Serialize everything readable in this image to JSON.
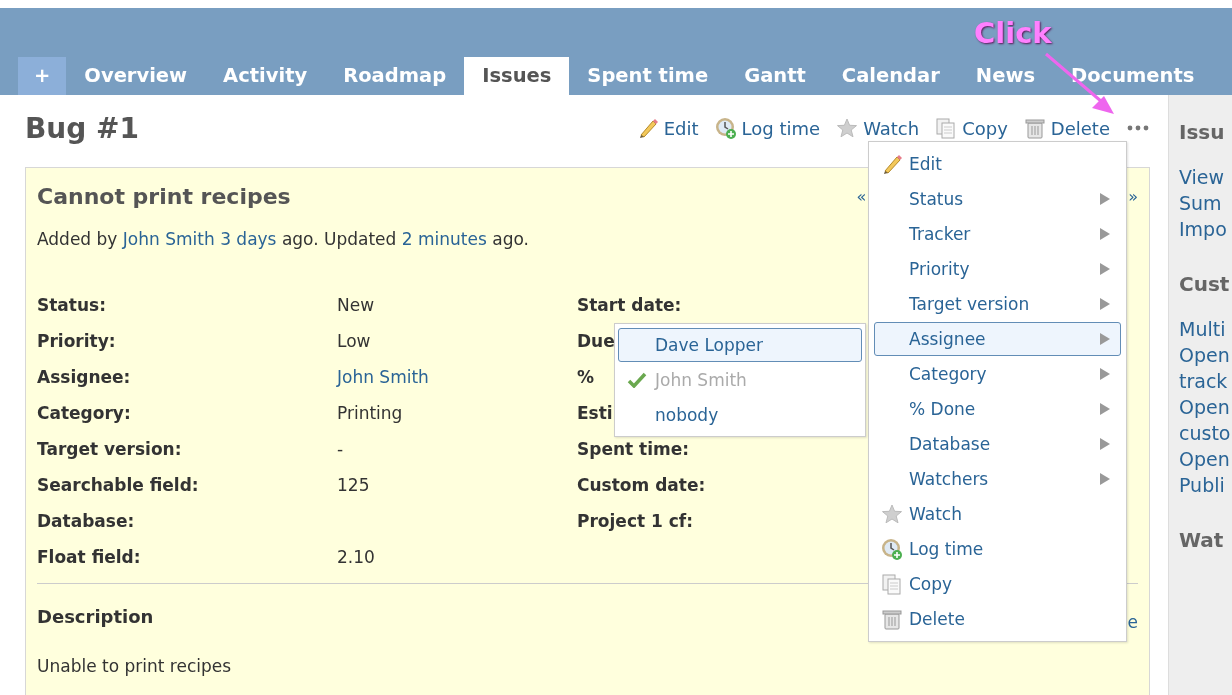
{
  "tabs": [
    {
      "label": "+",
      "kind": "new",
      "selected": false
    },
    {
      "label": "Overview",
      "kind": "tab",
      "selected": false
    },
    {
      "label": "Activity",
      "kind": "tab",
      "selected": false
    },
    {
      "label": "Roadmap",
      "kind": "tab",
      "selected": false
    },
    {
      "label": "Issues",
      "kind": "tab",
      "selected": true
    },
    {
      "label": "Spent time",
      "kind": "tab",
      "selected": false
    },
    {
      "label": "Gantt",
      "kind": "tab",
      "selected": false
    },
    {
      "label": "Calendar",
      "kind": "tab",
      "selected": false
    },
    {
      "label": "News",
      "kind": "tab",
      "selected": false
    },
    {
      "label": "Documents",
      "kind": "tab",
      "selected": false
    }
  ],
  "title": "Bug #1",
  "actions": [
    {
      "label": "Edit",
      "kind": "pencil"
    },
    {
      "label": "Log time",
      "kind": "clock"
    },
    {
      "label": "Watch",
      "kind": "star"
    },
    {
      "label": "Copy",
      "kind": "copy"
    },
    {
      "label": "Delete",
      "kind": "trash"
    }
  ],
  "issue": {
    "subject": "Cannot print recipes",
    "prev": "«",
    "next": "»",
    "author_line": {
      "prefix": "Added by",
      "author": "John Smith",
      "created": "3 days",
      "middle": "ago. Updated",
      "updated": "2 minutes",
      "suffix": "ago."
    },
    "attributes_left": [
      {
        "label": "Status:",
        "value": "New",
        "link": false
      },
      {
        "label": "Priority:",
        "value": "Low",
        "link": false
      },
      {
        "label": "Assignee:",
        "value": "John Smith",
        "link": true
      },
      {
        "label": "Category:",
        "value": "Printing",
        "link": false
      },
      {
        "label": "Target version:",
        "value": "-",
        "link": false
      },
      {
        "label": "Searchable field:",
        "value": "125",
        "link": false
      },
      {
        "label": "Database:"
      },
      {
        "label": "Float field:",
        "value": "2.10",
        "link": false
      }
    ],
    "attributes_right": [
      {
        "label": "Start date:"
      },
      {
        "label": "Due"
      },
      {
        "label": "%"
      },
      {
        "label": "Esti"
      },
      {
        "label": "Spent time:"
      },
      {
        "label": "Custom date:"
      },
      {
        "label": "Project 1 cf:"
      }
    ],
    "description_heading": "Description",
    "quote_link": "e",
    "description": "Unable to print recipes"
  },
  "sidebar": [
    {
      "kind": "heading",
      "text": "Issu"
    },
    {
      "kind": "link",
      "text": "View"
    },
    {
      "kind": "link",
      "text": "Sum"
    },
    {
      "kind": "link",
      "text": "Impo"
    },
    {
      "kind": "heading",
      "text": "Cust"
    },
    {
      "kind": "link",
      "text": "Multi"
    },
    {
      "kind": "link",
      "text": "Open"
    },
    {
      "kind": "link",
      "text": "track"
    },
    {
      "kind": "link",
      "text": "Open"
    },
    {
      "kind": "link",
      "text": "custo"
    },
    {
      "kind": "link",
      "text": "Open"
    },
    {
      "kind": "link",
      "text": "Publi"
    },
    {
      "kind": "heading",
      "text": "Wat"
    }
  ],
  "context_menu": [
    {
      "label": "Edit",
      "kind": "pencil",
      "submenu": false,
      "selected": false
    },
    {
      "label": "Status",
      "submenu": true,
      "selected": false
    },
    {
      "label": "Tracker",
      "submenu": true,
      "selected": false
    },
    {
      "label": "Priority",
      "submenu": true,
      "selected": false
    },
    {
      "label": "Target version",
      "submenu": true,
      "selected": false
    },
    {
      "label": "Assignee",
      "submenu": true,
      "selected": true
    },
    {
      "label": "Category",
      "submenu": true,
      "selected": false
    },
    {
      "label": "% Done",
      "submenu": true,
      "selected": false
    },
    {
      "label": "Database",
      "submenu": true,
      "selected": false
    },
    {
      "label": "Watchers",
      "submenu": true,
      "selected": false
    },
    {
      "label": "Watch",
      "kind": "star",
      "submenu": false,
      "selected": false
    },
    {
      "label": "Log time",
      "kind": "clock",
      "submenu": false,
      "selected": false
    },
    {
      "label": "Copy",
      "kind": "copy",
      "submenu": false,
      "selected": false
    },
    {
      "label": "Delete",
      "kind": "trash",
      "submenu": false,
      "selected": false
    }
  ],
  "assignee_menu": [
    {
      "label": "Dave Lopper",
      "selected": true,
      "checked": false,
      "disabled": false
    },
    {
      "label": "John Smith",
      "selected": false,
      "checked": true,
      "disabled": true
    },
    {
      "label": "nobody",
      "selected": false,
      "checked": false,
      "disabled": false
    }
  ],
  "annotation": {
    "text": "Click"
  }
}
